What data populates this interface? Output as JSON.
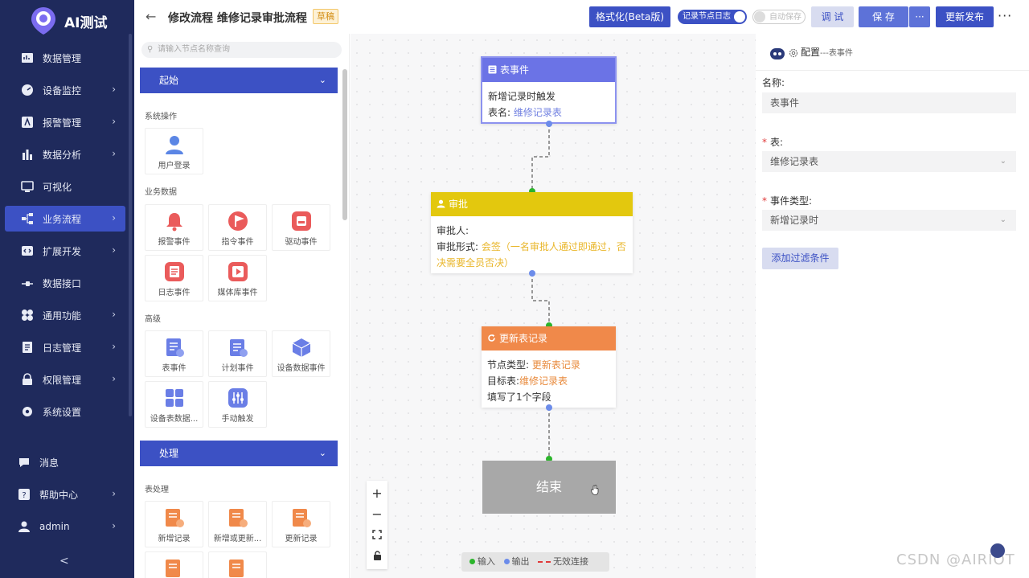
{
  "app": {
    "brand": "AI测试"
  },
  "nav": {
    "items": [
      {
        "label": "数据管理",
        "icon": "database-icon",
        "chevron": false
      },
      {
        "label": "设备监控",
        "icon": "monitor-icon",
        "chevron": true
      },
      {
        "label": "报警管理",
        "icon": "alarm-icon",
        "chevron": true
      },
      {
        "label": "数据分析",
        "icon": "bar-chart-icon",
        "chevron": true
      },
      {
        "label": "可视化",
        "icon": "screen-icon",
        "chevron": false
      },
      {
        "label": "业务流程",
        "icon": "flow-icon",
        "chevron": true,
        "active": true
      },
      {
        "label": "扩展开发",
        "icon": "code-icon",
        "chevron": true
      },
      {
        "label": "数据接口",
        "icon": "plug-icon",
        "chevron": false
      },
      {
        "label": "通用功能",
        "icon": "grid-icon",
        "chevron": true
      },
      {
        "label": "日志管理",
        "icon": "log-icon",
        "chevron": true
      },
      {
        "label": "权限管理",
        "icon": "lock-icon",
        "chevron": true
      },
      {
        "label": "系统设置",
        "icon": "gear-icon",
        "chevron": false
      }
    ],
    "bottom": [
      {
        "label": "消息",
        "icon": "message-icon",
        "chevron": false
      },
      {
        "label": "帮助中心",
        "icon": "help-icon",
        "chevron": true
      },
      {
        "label": "admin",
        "icon": "user-icon",
        "chevron": true
      }
    ],
    "collapse_glyph": "<"
  },
  "header": {
    "back_glyph": "←",
    "title": "修改流程 维修记录审批流程",
    "status_badge": "草稿",
    "format_btn": "格式化(Beta版)",
    "log_toggle": "记录节点日志",
    "autosave_toggle": "自动保存",
    "debug_btn": "调 试",
    "save_btn": "保 存",
    "save_more": "···",
    "publish_btn": "更新发布",
    "more": "···"
  },
  "panel": {
    "search_placeholder": "请输入节点名称查询",
    "section_start": "起始",
    "section_process": "处理",
    "groups": {
      "system_ops": "系统操作",
      "business_data": "业务数据",
      "advanced": "高级",
      "table_ops": "表处理"
    },
    "cards": {
      "user_login": "用户登录",
      "alarm_event": "报警事件",
      "command_event": "指令事件",
      "driver_event": "驱动事件",
      "log_event": "日志事件",
      "media_event": "媒体库事件",
      "table_event": "表事件",
      "schedule_event": "计划事件",
      "device_data_event": "设备数据事件",
      "device_table_data": "设备表数据...",
      "manual_trigger": "手动触发",
      "new_record": "新增记录",
      "add_or_update": "新增或更新...",
      "update_record": "更新记录"
    }
  },
  "canvas": {
    "node_table_event": {
      "title": "表事件",
      "line1": "新增记录时触发",
      "line2_label": "表名:",
      "line2_value": "维修记录表",
      "color": "#6b73e6"
    },
    "node_approval": {
      "title": "审批",
      "line1": "审批人:",
      "line2_label": "审批形式:",
      "line2_value": "会签（一名审批人通过即通过，否决需要全员否决）",
      "color": "#e3c80e"
    },
    "node_update": {
      "title": "更新表记录",
      "line1_label": "节点类型:",
      "line1_value": "更新表记录",
      "line2_label": "目标表:",
      "line2_value": "维修记录表",
      "line3": "填写了1个字段",
      "color": "#f0894a"
    },
    "node_end": {
      "title": "结束"
    },
    "legend": {
      "input": "输入",
      "output": "输出",
      "invalid": "无效连接"
    },
    "zoom": {
      "in": "+",
      "out": "−"
    }
  },
  "config": {
    "header_label": "配置",
    "header_sep": "---",
    "header_type": "表事件",
    "name_label": "名称:",
    "name_value": "表事件",
    "table_label": "表:",
    "table_value": "维修记录表",
    "event_type_label": "事件类型:",
    "event_type_value": "新增记录时",
    "required_mark": "*",
    "add_filter": "添加过滤条件"
  },
  "watermark": "CSDN @AIRIOT",
  "colors": {
    "nav_bg": "#1f2a5c",
    "accent": "#3c51c4",
    "input_port": "#2cb52c",
    "output_port": "#6c8cea",
    "invalid_link": "#e03a3a"
  }
}
